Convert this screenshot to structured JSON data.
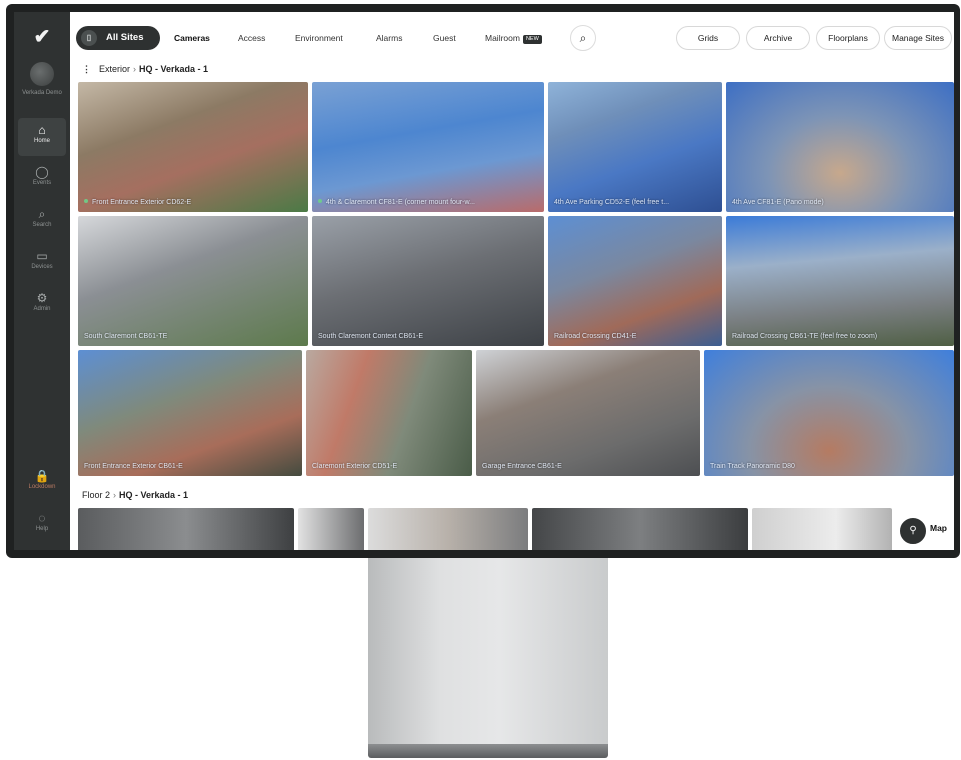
{
  "sidebar": {
    "logo": "✔",
    "workspace": "Verkada Demo",
    "items": [
      {
        "label": "Home",
        "icon": "home-icon",
        "glyph": "⌂"
      },
      {
        "label": "Events",
        "icon": "bell-icon",
        "glyph": "◯"
      },
      {
        "label": "Search",
        "icon": "search-icon",
        "glyph": "⌕"
      },
      {
        "label": "Devices",
        "icon": "devices-icon",
        "glyph": "▭"
      },
      {
        "label": "Admin",
        "icon": "gear-icon",
        "glyph": "⚙"
      },
      {
        "label": "Lockdown",
        "icon": "lock-icon",
        "glyph": "🔒"
      },
      {
        "label": "Help",
        "icon": "chat-icon",
        "glyph": "◌"
      }
    ]
  },
  "nav": {
    "all_sites": "All Sites",
    "all_sites_icon": "▯",
    "tabs": [
      "Cameras",
      "Access",
      "Environment",
      "Alarms",
      "Guest",
      "Mailroom"
    ],
    "new_badge": "NEW",
    "search_icon": "⌕",
    "right_buttons": [
      "Grids",
      "Archive",
      "Floorplans",
      "Manage Sites"
    ]
  },
  "sections": [
    {
      "menu": "⋮",
      "parent": "Exterior",
      "site": "HQ - Verkada - 1"
    },
    {
      "parent": "Floor 2",
      "site": "HQ - Verkada - 1"
    }
  ],
  "cameras": [
    "Front Entrance Exterior CD62-E",
    "4th & Claremont CF81-E (corner mount four-w...",
    "4th Ave Parking CD52-E (feel free t...",
    "4th Ave CF81-E (Pano mode)",
    "South Claremont CB61-TE",
    "South Claremont Context CB61-E",
    "Railroad Crossing CD41-E",
    "Railroad Crossing CB61-TE (feel free to zoom)",
    "Front Entrance Exterior CB61-E",
    "Claremont Exterior CD51-E",
    "Garage Entrance CB61-E",
    "Train Track Panoramic D80"
  ],
  "map": {
    "label": "Map",
    "icon": "map-icon",
    "glyph": "⚲"
  },
  "colors": {
    "sidebar": "#2f3232",
    "accent_dark": "#2e3131",
    "status_dot": "#6fd08a"
  }
}
